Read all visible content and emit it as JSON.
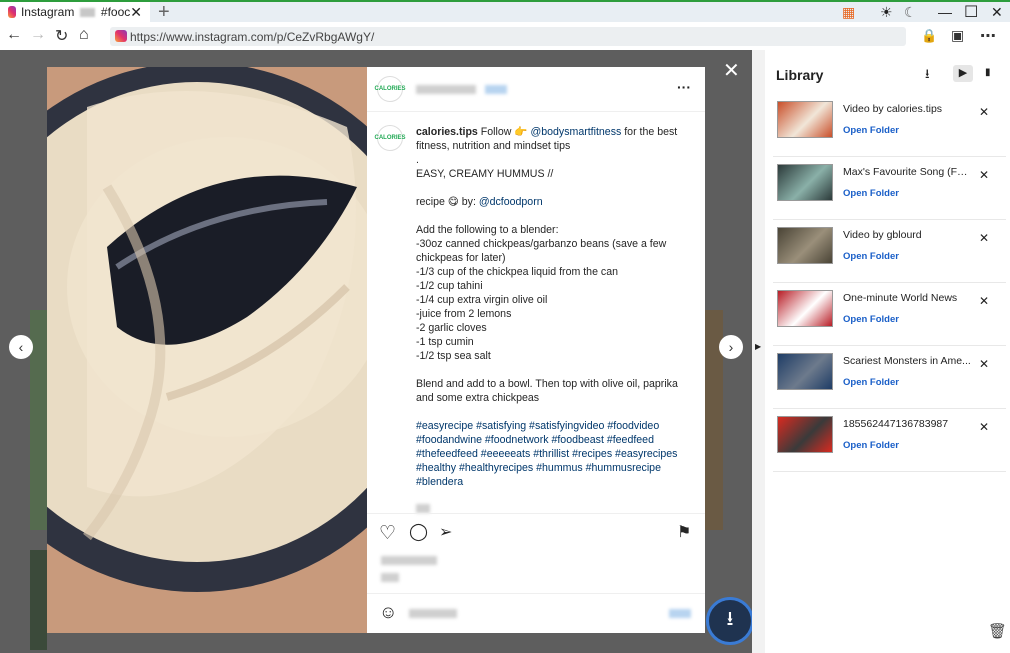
{
  "tab": {
    "title_start": "Instagram",
    "title_end": "#fooc",
    "close": "✕",
    "new_tab": "+"
  },
  "window": {
    "gift": "▦",
    "theme": "☀",
    "moon": "☾",
    "minimize": "—",
    "maximize": "☐",
    "close": "✕"
  },
  "toolbar": {
    "back": "←",
    "forward": "→",
    "reload": "↻",
    "home": "⌂",
    "url": "https://www.instagram.com/p/CeZvRbgAWgY/",
    "lock": "🔒",
    "ext": "▣",
    "menu": "⋯"
  },
  "post": {
    "avatar_text": "CALORIES",
    "more": "···",
    "close": "✕",
    "prev": "‹",
    "next": "›",
    "caption_user": "calories.tips",
    "caption_follow": " Follow 👉 ",
    "caption_mention1": "@bodysmartfitness",
    "caption_rest1": " for the best fitness, nutrition and mindset tips\n.\nEASY, CREAMY HUMMUS //\n\nrecipe 😋 by: ",
    "caption_mention2": "@dcfoodporn",
    "caption_body": "\n\nAdd the following to a blender:\n-30oz canned chickpeas/garbanzo beans (save a few chickpeas for later)\n-1/3 cup of the chickpea liquid from the can\n-1/2 cup tahini\n-1/4 cup extra virgin olive oil\n-juice from 2 lemons\n-2 garlic cloves\n-1 tsp cumin\n-1/2 tsp sea salt\n\nBlend and add to a bowl. Then top with olive oil, paprika and some extra chickpeas\n\n",
    "hashtags": "#easyrecipe #satisfying #satisfyingvideo #foodvideo #foodandwine #foodnetwork #foodbeast #feedfeed #thefeedfeed #eeeeeats #thrillist #recipes #easyrecipes #healthy #healthyrecipes #hummus #hummusrecipe #blendera",
    "like_icon": "♡",
    "comment_icon": "◯",
    "share_icon": "➢",
    "save_icon": "⚑",
    "emoji_icon": "☺"
  },
  "fab_icon": "⭳",
  "library": {
    "title": "Library",
    "download_icon": "⭳",
    "video_icon": "▶",
    "audio_icon": "▮",
    "trash": "🗑",
    "items": [
      {
        "title": "Video by calories.tips",
        "link": "Open Folder",
        "remove": "✕",
        "color1": "#c94f2a",
        "color2": "#f1e6d8"
      },
      {
        "title": "Max's Favourite Song (Ful...",
        "link": "Open Folder",
        "remove": "✕",
        "color1": "#2c3a3a",
        "color2": "#8ab0a8"
      },
      {
        "title": "Video by gblourd",
        "link": "Open Folder",
        "remove": "✕",
        "color1": "#4a4436",
        "color2": "#9a8f7a"
      },
      {
        "title": "One-minute World News",
        "link": "Open Folder",
        "remove": "✕",
        "color1": "#b81d26",
        "color2": "#ffffff"
      },
      {
        "title": "Scariest Monsters in Ame...",
        "link": "Open Folder",
        "remove": "✕",
        "color1": "#1f3d66",
        "color2": "#6d7a8c"
      },
      {
        "title": "185562447136783987",
        "link": "Open Folder",
        "remove": "✕",
        "color1": "#d92a20",
        "color2": "#3a3a3a"
      }
    ]
  }
}
